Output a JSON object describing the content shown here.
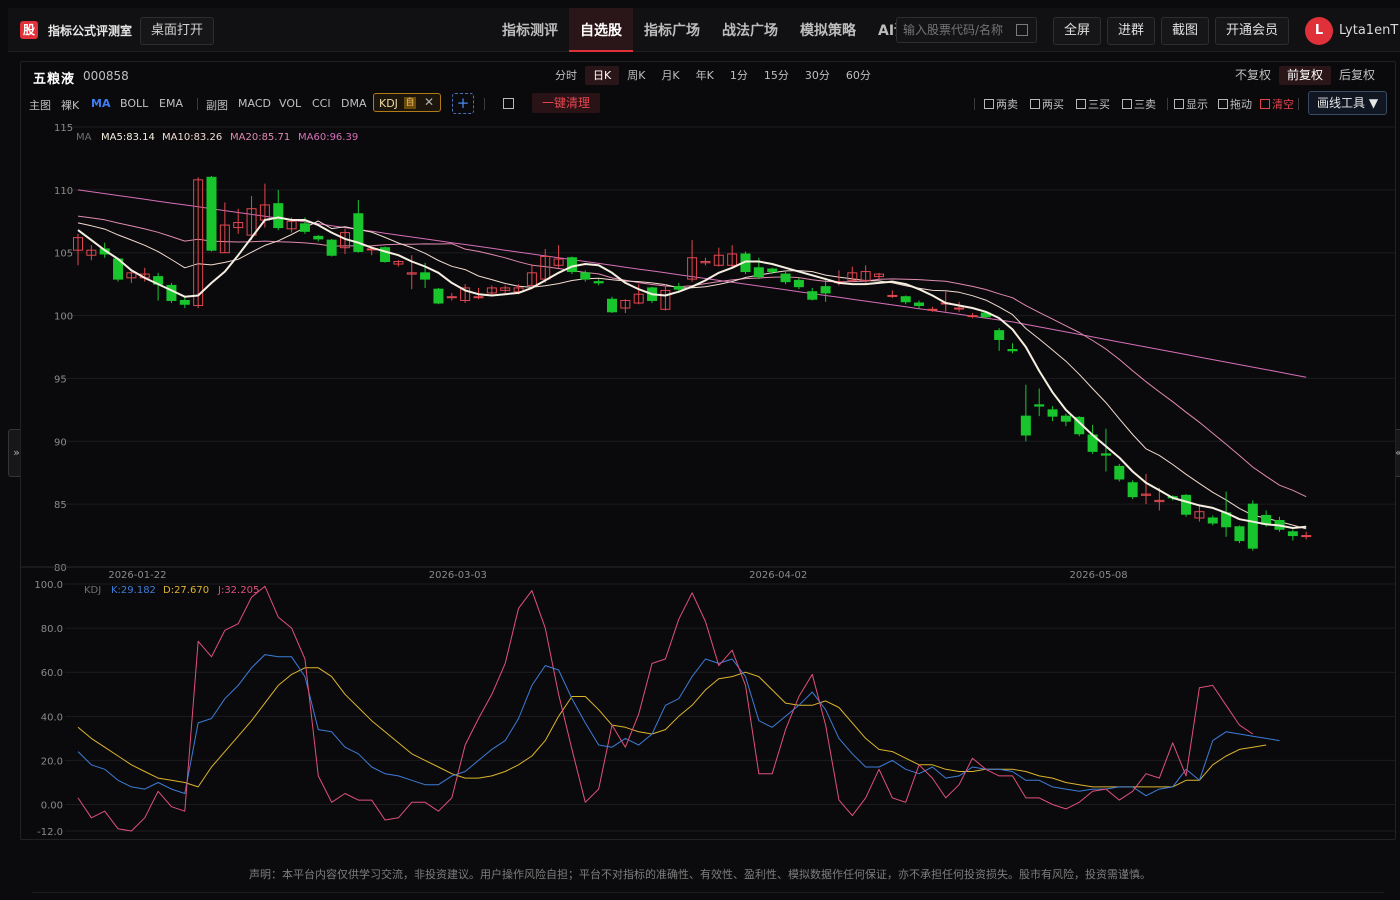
{
  "app": {
    "logo_text": "股",
    "title": "指标公式评测室",
    "desktop_button": "桌面打开"
  },
  "nav": [
    {
      "label": "指标测评",
      "active": false
    },
    {
      "label": "自选股",
      "active": true
    },
    {
      "label": "指标广场",
      "active": false
    },
    {
      "label": "战法广场",
      "active": false
    },
    {
      "label": "模拟策略",
      "active": false
    },
    {
      "label": "AI读K测评",
      "active": false
    }
  ],
  "search": {
    "placeholder": "输入股票代码/名称"
  },
  "toolbar": {
    "fullscreen": "全屏",
    "join_group": "进群",
    "screenshot": "截图",
    "membership": "开通会员"
  },
  "user": {
    "avatar_letter": "L",
    "name": "Lyta1enT"
  },
  "stock": {
    "name": "五粮液",
    "code": "000858"
  },
  "periods": [
    {
      "label": "分时",
      "active": false
    },
    {
      "label": "日K",
      "active": true
    },
    {
      "label": "周K",
      "active": false
    },
    {
      "label": "月K",
      "active": false
    },
    {
      "label": "年K",
      "active": false
    },
    {
      "label": "1分",
      "active": false
    },
    {
      "label": "15分",
      "active": false
    },
    {
      "label": "30分",
      "active": false
    },
    {
      "label": "60分",
      "active": false
    }
  ],
  "adjusts": [
    {
      "label": "不复权",
      "active": false
    },
    {
      "label": "前复权",
      "active": true
    },
    {
      "label": "后复权",
      "active": false
    }
  ],
  "indicator_bar": {
    "main_label": "主图",
    "bare_k": "裸K",
    "ma": "MA",
    "boll": "BOLL",
    "ema": "EMA",
    "sub_label": "副图",
    "macd": "MACD",
    "vol": "VOL",
    "cci": "CCI",
    "dma": "DMA",
    "kdj_tag": "KDJ",
    "kdj_self": "自",
    "plus": "+",
    "clear": "一键清理"
  },
  "tools": [
    {
      "label": "两卖",
      "red": false
    },
    {
      "label": "两买",
      "red": false
    },
    {
      "label": "三买",
      "red": false
    },
    {
      "label": "三卖",
      "red": false
    },
    {
      "label": "显示",
      "red": false
    },
    {
      "label": "拖动",
      "red": false
    },
    {
      "label": "清空",
      "red": true
    }
  ],
  "draw_tools": "画线工具 ▼",
  "colors": {
    "up": "#e0474f",
    "down": "#19c52c",
    "ma5": "#f6eee0",
    "ma10": "#f2dad0",
    "ma20": "#e08ab0",
    "ma60": "#d66fb8",
    "k": "#3e7cd8",
    "d": "#dcb42c",
    "j": "#e0507a",
    "accent": "#e0313a"
  },
  "chart_data": [
    {
      "type": "candlestick",
      "title": "",
      "ma_legend": {
        "name": "MA",
        "items": [
          "MA5:83.14",
          "MA10:83.26",
          "MA20:85.71",
          "MA60:96.39"
        ]
      },
      "ylim": [
        80,
        115
      ],
      "y_ticks": [
        "115",
        "110",
        "105",
        "100",
        "95",
        "90",
        "85",
        "80"
      ],
      "x_ticks": [
        {
          "label": "2026-01-22",
          "index": 4
        },
        {
          "label": "2026-03-03",
          "index": 28
        },
        {
          "label": "2026-04-02",
          "index": 52
        },
        {
          "label": "2026-05-08",
          "index": 76
        }
      ],
      "candles": [
        [
          105.2,
          106.2,
          104.0,
          106.5
        ],
        [
          104.8,
          105.2,
          104.4,
          105.6
        ],
        [
          105.3,
          104.9,
          104.6,
          105.8
        ],
        [
          104.5,
          102.9,
          102.7,
          104.6
        ],
        [
          103.0,
          103.4,
          102.6,
          103.7
        ],
        [
          103.0,
          103.3,
          102.7,
          103.8
        ],
        [
          103.1,
          102.5,
          101.2,
          103.4
        ],
        [
          102.4,
          101.2,
          101.0,
          102.6
        ],
        [
          101.2,
          100.9,
          100.6,
          101.5
        ],
        [
          100.8,
          110.8,
          100.6,
          111.0
        ],
        [
          111.0,
          105.2,
          105.1,
          111.1
        ],
        [
          105.0,
          107.2,
          105.0,
          109.0
        ],
        [
          107.0,
          107.4,
          106.5,
          108.5
        ],
        [
          106.4,
          108.5,
          106.0,
          109.5
        ],
        [
          107.6,
          108.8,
          107.0,
          110.5
        ],
        [
          108.9,
          107.0,
          106.8,
          110.0
        ],
        [
          106.9,
          107.5,
          106.6,
          107.8
        ],
        [
          107.3,
          106.7,
          106.5,
          107.8
        ],
        [
          106.3,
          106.1,
          105.9,
          106.4
        ],
        [
          106.0,
          104.8,
          104.7,
          106.1
        ],
        [
          105.4,
          106.6,
          104.9,
          106.9
        ],
        [
          108.1,
          105.1,
          105.0,
          109.2
        ],
        [
          105.3,
          105.3,
          104.8,
          105.6
        ],
        [
          105.4,
          104.3,
          104.2,
          105.5
        ],
        [
          104.1,
          104.3,
          103.9,
          104.4
        ],
        [
          103.3,
          103.4,
          102.1,
          104.8
        ],
        [
          103.4,
          102.9,
          102.2,
          104.2
        ],
        [
          102.1,
          101.0,
          100.9,
          102.2
        ],
        [
          101.5,
          101.5,
          101.2,
          101.8
        ],
        [
          101.2,
          102.2,
          101.0,
          102.5
        ],
        [
          101.5,
          101.5,
          101.3,
          102.2
        ],
        [
          101.8,
          102.2,
          101.6,
          102.4
        ],
        [
          102.0,
          102.2,
          101.8,
          102.4
        ],
        [
          101.9,
          102.2,
          101.7,
          102.5
        ],
        [
          102.4,
          103.4,
          102.1,
          104.1
        ],
        [
          102.9,
          104.7,
          102.6,
          105.3
        ],
        [
          104.0,
          104.5,
          103.8,
          105.6
        ],
        [
          104.6,
          103.5,
          103.3,
          104.7
        ],
        [
          103.4,
          102.9,
          102.7,
          103.6
        ],
        [
          102.7,
          102.6,
          102.4,
          102.9
        ],
        [
          101.3,
          100.3,
          100.2,
          101.5
        ],
        [
          100.6,
          101.2,
          100.2,
          101.3
        ],
        [
          101.0,
          101.7,
          100.9,
          102.5
        ],
        [
          102.2,
          101.2,
          101.0,
          102.3
        ],
        [
          100.5,
          102.0,
          100.4,
          102.5
        ],
        [
          102.3,
          102.1,
          101.8,
          102.6
        ],
        [
          102.9,
          104.6,
          102.7,
          106.0
        ],
        [
          104.2,
          104.3,
          104.0,
          104.6
        ],
        [
          104.0,
          104.8,
          103.9,
          105.4
        ],
        [
          104.0,
          104.9,
          103.8,
          105.6
        ],
        [
          104.9,
          103.5,
          103.3,
          105.1
        ],
        [
          103.8,
          103.1,
          102.9,
          104.6
        ],
        [
          103.7,
          103.5,
          103.3,
          103.8
        ],
        [
          103.3,
          102.7,
          102.5,
          103.6
        ],
        [
          102.8,
          102.3,
          102.1,
          103.0
        ],
        [
          101.9,
          101.3,
          101.2,
          102.2
        ],
        [
          102.3,
          101.8,
          101.1,
          103.0
        ],
        [
          102.7,
          102.7,
          102.4,
          103.6
        ],
        [
          102.8,
          103.4,
          102.7,
          103.9
        ],
        [
          102.8,
          103.5,
          102.6,
          104.0
        ],
        [
          103.1,
          103.3,
          102.9,
          103.4
        ],
        [
          101.6,
          101.6,
          101.4,
          102.0
        ],
        [
          101.5,
          101.1,
          100.9,
          101.6
        ],
        [
          101.0,
          100.8,
          100.6,
          101.2
        ],
        [
          100.5,
          100.5,
          100.3,
          100.7
        ],
        [
          101.0,
          101.0,
          100.3,
          101.9
        ],
        [
          100.6,
          100.6,
          100.3,
          101.1
        ],
        [
          100.0,
          100.0,
          99.8,
          100.2
        ],
        [
          100.2,
          99.9,
          99.8,
          100.2
        ],
        [
          98.8,
          98.1,
          97.2,
          99.0
        ],
        [
          97.3,
          97.2,
          97.0,
          97.8
        ],
        [
          92.0,
          90.5,
          90.0,
          94.5
        ],
        [
          92.9,
          92.8,
          92.0,
          94.2
        ],
        [
          92.5,
          92.0,
          91.6,
          92.8
        ],
        [
          92.0,
          91.6,
          91.2,
          92.2
        ],
        [
          91.9,
          90.6,
          90.4,
          92.0
        ],
        [
          90.5,
          89.2,
          89.0,
          91.3
        ],
        [
          89.0,
          88.9,
          87.6,
          91.0
        ],
        [
          88.0,
          87.0,
          86.8,
          88.2
        ],
        [
          86.7,
          85.6,
          85.4,
          86.9
        ],
        [
          85.7,
          85.8,
          85.0,
          87.4
        ],
        [
          85.2,
          85.3,
          84.5,
          86.3
        ],
        [
          85.6,
          85.5,
          85.3,
          85.7
        ],
        [
          85.7,
          84.2,
          84.0,
          85.8
        ],
        [
          83.9,
          84.4,
          83.6,
          84.9
        ],
        [
          83.9,
          83.5,
          83.3,
          84.1
        ],
        [
          84.3,
          83.2,
          82.4,
          86.0
        ],
        [
          83.2,
          82.1,
          81.9,
          83.3
        ],
        [
          85.0,
          81.5,
          81.3,
          85.3
        ],
        [
          84.1,
          83.4,
          83.2,
          84.5
        ],
        [
          83.7,
          83.0,
          82.8,
          84.0
        ],
        [
          82.8,
          82.5,
          82.1,
          83.0
        ],
        [
          82.5,
          82.5,
          82.2,
          82.8
        ]
      ],
      "ma5": [
        106.8,
        106.0,
        105.2,
        104.5,
        103.6,
        103.0,
        102.5,
        102.0,
        101.5,
        101.6,
        102.6,
        103.5,
        104.8,
        106.2,
        107.6,
        107.8,
        107.6,
        107.6,
        107.2,
        106.6,
        106.1,
        105.8,
        105.4,
        105.1,
        104.8,
        104.3,
        103.9,
        103.4,
        102.6,
        102.0,
        101.7,
        101.6,
        101.7,
        101.8,
        102.2,
        102.8,
        103.4,
        103.9,
        104.1,
        104.0,
        103.4,
        102.6,
        102.1,
        101.7,
        101.6,
        101.9,
        102.3,
        102.8,
        103.4,
        103.8,
        104.3,
        104.3,
        104.1,
        103.8,
        103.5,
        103.2,
        102.9,
        102.6,
        102.5,
        102.5,
        102.6,
        102.7,
        102.5,
        102.1,
        101.6,
        101.0,
        100.8,
        100.6,
        100.3,
        99.8,
        98.9,
        97.5,
        95.6,
        93.9,
        92.5,
        91.5,
        90.5,
        89.6,
        88.7,
        87.6,
        86.7,
        86.1,
        85.5,
        85.2,
        84.9,
        84.7,
        84.3,
        83.8,
        83.6,
        83.4,
        83.3,
        83.1,
        83.2
      ]
    },
    {
      "type": "line",
      "title": "",
      "legend": {
        "name": "KDJ",
        "items": [
          {
            "label": "K:29.182",
            "key": "k"
          },
          {
            "label": "D:27.670",
            "key": "d"
          },
          {
            "label": "J:32.205",
            "key": "j"
          }
        ]
      },
      "ylim": [
        -12,
        100
      ],
      "y_ticks": [
        "100.0",
        "80.0",
        "60.0",
        "40.0",
        "20.0",
        "0.00",
        "-12.0"
      ],
      "series": [
        {
          "name": "K",
          "values": [
            24,
            18,
            16,
            11,
            8,
            7,
            10,
            7,
            5,
            37,
            39,
            48,
            54,
            62,
            68,
            67,
            67,
            58,
            34,
            33,
            26,
            23,
            17,
            14,
            13,
            11,
            9,
            9,
            13,
            15,
            20,
            25,
            29,
            39,
            54,
            63,
            61,
            48,
            37,
            27,
            26,
            30,
            27,
            32,
            45,
            48,
            58,
            66,
            64,
            66,
            58,
            38,
            35,
            40,
            45,
            51,
            43,
            30,
            23,
            17,
            17,
            20,
            16,
            14,
            17,
            12,
            13,
            17,
            16,
            16,
            15,
            11,
            11,
            8,
            7,
            6,
            7,
            7,
            8,
            8,
            4,
            7,
            8,
            16,
            11,
            29,
            33,
            32,
            31,
            30,
            29
          ]
        },
        {
          "name": "D",
          "values": [
            35,
            30,
            26,
            22,
            18,
            15,
            12,
            11,
            10,
            8,
            17,
            24,
            31,
            38,
            46,
            54,
            59,
            62,
            62,
            58,
            50,
            44,
            38,
            33,
            28,
            23,
            20,
            17,
            14,
            12,
            12,
            13,
            15,
            18,
            22,
            29,
            40,
            49,
            49,
            43,
            36,
            35,
            33,
            32,
            34,
            40,
            45,
            52,
            57,
            58,
            60,
            58,
            52,
            46,
            45,
            45,
            47,
            44,
            37,
            30,
            25,
            24,
            21,
            18,
            18,
            16,
            15,
            15,
            16,
            16,
            16,
            15,
            13,
            12,
            10,
            9,
            8,
            8,
            8,
            8,
            8,
            8,
            8,
            11,
            11,
            18,
            22,
            25,
            26,
            27
          ]
        },
        {
          "name": "J",
          "values": [
            3,
            -6,
            -3,
            -11,
            -12,
            -6,
            6,
            -1,
            -3,
            74,
            67,
            79,
            82,
            94,
            99,
            85,
            80,
            66,
            13,
            1,
            5,
            2,
            2,
            -7,
            -6,
            1,
            1,
            -3,
            3,
            27,
            39,
            50,
            64,
            89,
            97,
            80,
            50,
            25,
            1,
            7,
            36,
            26,
            41,
            64,
            66,
            84,
            96,
            83,
            63,
            70,
            54,
            14,
            14,
            34,
            49,
            59,
            36,
            2,
            -5,
            3,
            16,
            3,
            1,
            18,
            12,
            3,
            9,
            21,
            16,
            13,
            13,
            3,
            3,
            0,
            -2,
            1,
            6,
            7,
            2,
            6,
            14,
            12,
            28,
            13,
            53,
            54,
            45,
            36,
            32
          ]
        }
      ]
    }
  ],
  "disclaimer": "声明：本平台内容仅供学习交流，非投资建议。用户操作风险自担；平台不对指标的准确性、有效性、盈利性、模拟数据作任何保证，亦不承担任何投资损失。股市有风险，投资需谨慎。"
}
